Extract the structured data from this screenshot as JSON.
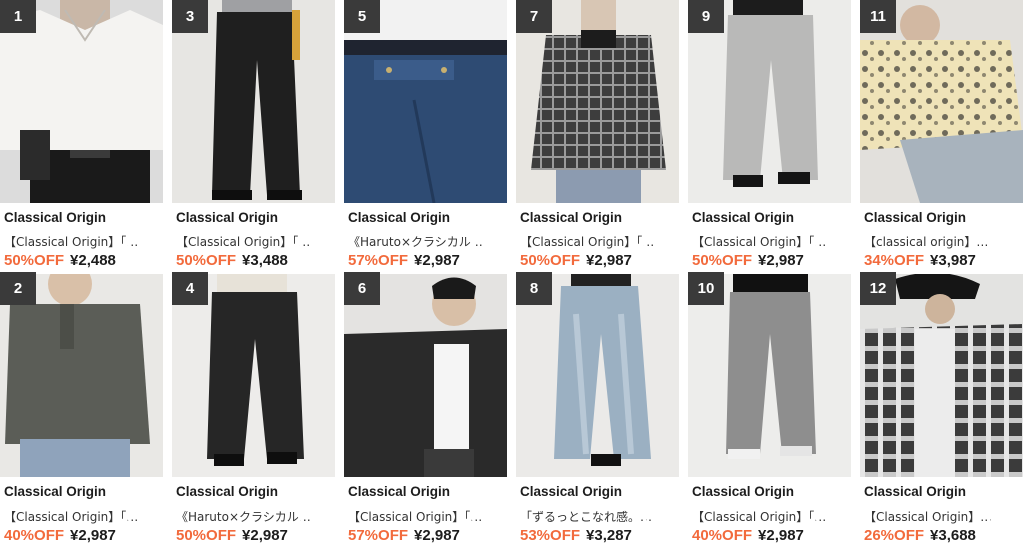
{
  "colors": {
    "discount": "#f26a3c",
    "rank_badge": "#3a3a3a",
    "heart_outline": "#ffffff"
  },
  "products": [
    {
      "rank": "1",
      "brand": "Classical Origin",
      "name": "【Classical Origin】「…",
      "discount": "50%OFF",
      "price": "¥2,488",
      "favorite_icon": "heart-outline-icon"
    },
    {
      "rank": "3",
      "brand": "Classical Origin",
      "name": "【Classical Origin】「…",
      "discount": "50%OFF",
      "price": "¥3,488",
      "favorite_icon": "heart-outline-icon"
    },
    {
      "rank": "5",
      "brand": "Classical Origin",
      "name": "《Haruto×クラシカル…",
      "discount": "57%OFF",
      "price": "¥2,987",
      "favorite_icon": "heart-outline-icon"
    },
    {
      "rank": "7",
      "brand": "Classical Origin",
      "name": "【Classical Origin】「…",
      "discount": "50%OFF",
      "price": "¥2,987",
      "favorite_icon": "heart-outline-icon"
    },
    {
      "rank": "9",
      "brand": "Classical Origin",
      "name": "【Classical Origin】「…",
      "discount": "50%OFF",
      "price": "¥2,987",
      "favorite_icon": "heart-outline-icon"
    },
    {
      "rank": "11",
      "brand": "Classical Origin",
      "name": "【classical origin】…",
      "discount": "34%OFF",
      "price": "¥3,987",
      "favorite_icon": "heart-outline-icon"
    },
    {
      "rank": "2",
      "brand": "Classical Origin",
      "name": "【Classical Origin】「…",
      "discount": "40%OFF",
      "price": "¥2,987",
      "favorite_icon": "heart-outline-icon"
    },
    {
      "rank": "4",
      "brand": "Classical Origin",
      "name": "《Haruto×クラシカル…",
      "discount": "50%OFF",
      "price": "¥2,987",
      "favorite_icon": "heart-outline-icon"
    },
    {
      "rank": "6",
      "brand": "Classical Origin",
      "name": "【Classical Origin】「…",
      "discount": "57%OFF",
      "price": "¥2,987",
      "favorite_icon": "heart-outline-icon"
    },
    {
      "rank": "8",
      "brand": "Classical Origin",
      "name": "「ずるっとこなれ感。…",
      "discount": "53%OFF",
      "price": "¥3,287",
      "favorite_icon": "heart-outline-icon"
    },
    {
      "rank": "10",
      "brand": "Classical Origin",
      "name": "【Classical Origin】「…",
      "discount": "40%OFF",
      "price": "¥2,987",
      "favorite_icon": "heart-outline-icon"
    },
    {
      "rank": "12",
      "brand": "Classical Origin",
      "name": "【Classical Origin】…",
      "discount": "26%OFF",
      "price": "¥3,688",
      "favorite_icon": "heart-outline-icon"
    }
  ]
}
